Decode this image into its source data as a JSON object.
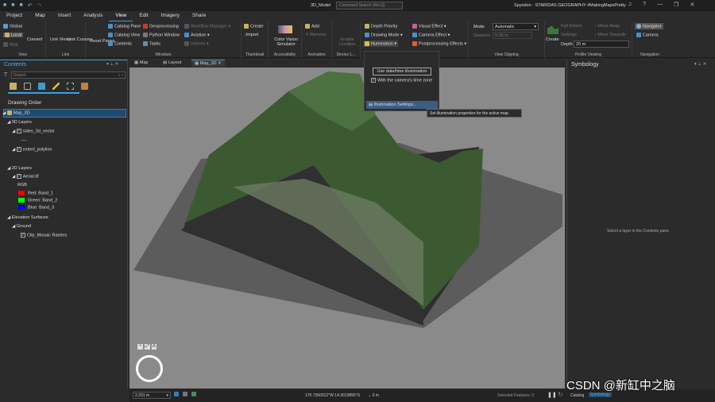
{
  "title_bar": {
    "project": "3D_Model",
    "search_placeholder": "Command Search (Alt+Q)",
    "user": "Spyridon - STARIDAS GEOGRAPHY #MakingMapsPretty"
  },
  "ribbon_tabs": [
    "Project",
    "Map",
    "Insert",
    "Analysis",
    "View",
    "Edit",
    "Imagery",
    "Share"
  ],
  "ribbon": {
    "view": {
      "global": "Global",
      "local": "Local",
      "map": "Map",
      "convert": "Convert",
      "label": "View"
    },
    "link": {
      "link_views": "Link Views",
      "link_cursors": "Link Cursors",
      "label": "Link"
    },
    "windows": {
      "reset_panes": "Reset Panes",
      "catalog_pane": "Catalog Pane",
      "catalog_view": "Catalog View",
      "contents": "Contents",
      "geoprocessing": "Geoprocessing",
      "python_window": "Python Window",
      "tasks": "Tasks",
      "workflow_manager": "Workflow Manager",
      "aviation": "Aviation",
      "indoors": "Indoors",
      "label": "Windows"
    },
    "thumbnail": {
      "create": "Create",
      "import": "Import",
      "label": "Thumbnail"
    },
    "accessibility": {
      "cvs": "Color Vision Simulator",
      "label": "Accessibility"
    },
    "animation": {
      "add": "Add",
      "remove": "Remove",
      "label": "Animation"
    },
    "device": {
      "enable_location": "Enable Location",
      "label": "Device L..."
    },
    "scene": {
      "depth_priority": "Depth Priority",
      "drawing_mode": "Drawing Mode",
      "illumination": "Illumination",
      "visual_effect": "Visual Effect",
      "camera_effect": "Camera Effect",
      "postprocessing": "Postprocessing Effects"
    },
    "clipping": {
      "mode_label": "Mode",
      "mode_value": "Automatic",
      "distance_label": "Distance",
      "distance_value": "0.05 m",
      "label": "View Clipping"
    },
    "profile": {
      "create": "Create",
      "full_extent": "Full Extent",
      "settings": "Settings",
      "move_away": "Move Away",
      "move_towards": "Move Towards",
      "depth_label": "Depth",
      "depth_value": "20 m",
      "label": "Profile Viewing"
    },
    "navigation": {
      "navigator": "Navigator",
      "camera": "Camera",
      "label": "Navigation"
    }
  },
  "illumination_menu": {
    "use_datetime": "Use date/time illumination",
    "camera_tz": "With the camera's time zone",
    "settings": "Illumination Settings...",
    "tooltip": "Set illumination properties for the active map."
  },
  "contents": {
    "title": "Contents",
    "search_placeholder": "Search",
    "drawing_order": "Drawing Order",
    "map": "Map_3D",
    "group_3d": "3D Layers",
    "layer1": "sides_3d_vector",
    "layer2": "extent_polyline",
    "group_2d": "2D Layers",
    "raster": "Aerial.tif",
    "rgb": "RGB",
    "red": "Red:  Band_1",
    "green": "Green: Band_2",
    "blue": "Blue:  Band_3",
    "elev": "Elevation Surfaces",
    "ground": "Ground",
    "clip": "Clip_Mosaic Rasters"
  },
  "doc_tabs": [
    "Map",
    "Layout",
    "Map_3D"
  ],
  "symbology": {
    "title": "Symbology",
    "message": "Select a layer in the Contents pane."
  },
  "status": {
    "scale": "2,291 m",
    "coords": "170.7350912°W 14.3013895°S",
    "elev": "0 m",
    "selected": "Selected Features: 0",
    "catalog": "Catalog",
    "symbology": "Symbology"
  },
  "watermark": "CSDN @新缸中之脑"
}
